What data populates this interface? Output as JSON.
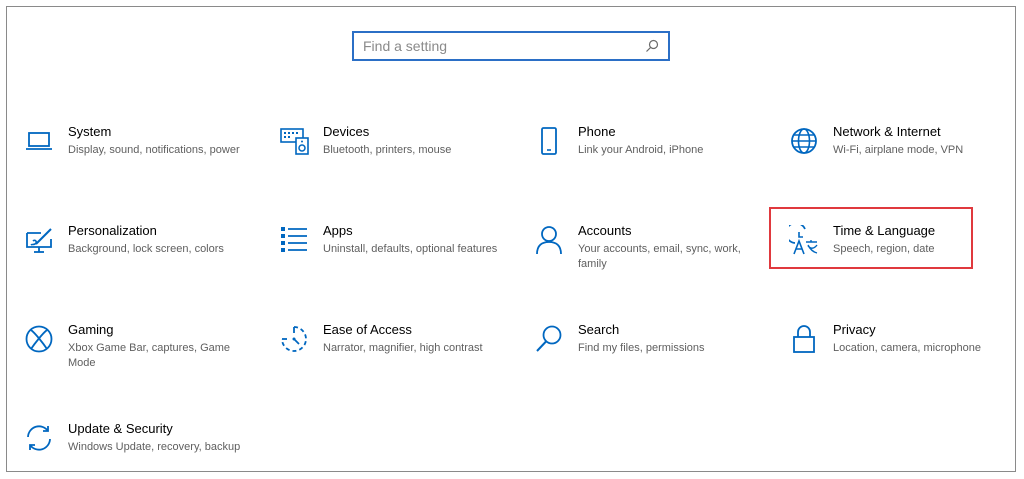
{
  "search": {
    "placeholder": "Find a setting",
    "icon": "search-icon"
  },
  "colors": {
    "accent": "#0067c0",
    "highlight": "#e0393e",
    "search_border": "#2b6fc6"
  },
  "tiles": [
    {
      "title": "System",
      "desc": "Display, sound, notifications, power",
      "icon": "laptop-icon"
    },
    {
      "title": "Devices",
      "desc": "Bluetooth, printers, mouse",
      "icon": "keyboard-speaker-icon"
    },
    {
      "title": "Phone",
      "desc": "Link your Android, iPhone",
      "icon": "phone-icon"
    },
    {
      "title": "Network & Internet",
      "desc": "Wi-Fi, airplane mode, VPN",
      "icon": "globe-icon"
    },
    {
      "title": "Personalization",
      "desc": "Background, lock screen, colors",
      "icon": "paint-monitor-icon"
    },
    {
      "title": "Apps",
      "desc": "Uninstall, defaults, optional features",
      "icon": "apps-list-icon"
    },
    {
      "title": "Accounts",
      "desc": "Your accounts, email, sync, work, family",
      "icon": "person-icon"
    },
    {
      "title": "Time & Language",
      "desc": "Speech, region, date",
      "icon": "time-language-icon"
    },
    {
      "title": "Gaming",
      "desc": "Xbox Game Bar, captures, Game Mode",
      "icon": "xbox-icon"
    },
    {
      "title": "Ease of Access",
      "desc": "Narrator, magnifier, high contrast",
      "icon": "ease-of-access-icon"
    },
    {
      "title": "Search",
      "desc": "Find my files, permissions",
      "icon": "search-icon"
    },
    {
      "title": "Privacy",
      "desc": "Location, camera, microphone",
      "icon": "lock-icon"
    },
    {
      "title": "Update & Security",
      "desc": "Windows Update, recovery, backup",
      "icon": "sync-icon"
    }
  ]
}
